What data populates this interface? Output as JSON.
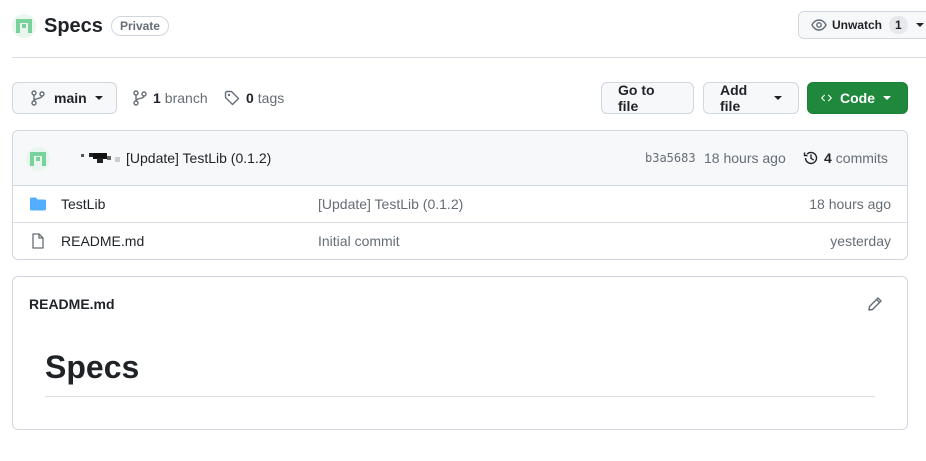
{
  "repo": {
    "name": "Specs",
    "visibility": "Private",
    "avatar_icon": "repo-avatar-identicon"
  },
  "watch": {
    "label": "Unwatch",
    "count": "1",
    "icon": "eye-icon"
  },
  "toolbar": {
    "branch_label": "main",
    "branch_count": "1",
    "branch_word": "branch",
    "tag_count": "0",
    "tag_word": "tags",
    "go_to_file": "Go to file",
    "add_file": "Add file",
    "code": "Code"
  },
  "latest_commit": {
    "message": "[Update] TestLib (0.1.2)",
    "sha": "b3a5683",
    "time": "18 hours ago",
    "commit_count": "4",
    "commit_word": "commits"
  },
  "files": [
    {
      "type": "folder",
      "name": "TestLib",
      "commit": "[Update] TestLib (0.1.2)",
      "age": "18 hours ago"
    },
    {
      "type": "file",
      "name": "README.md",
      "commit": "Initial commit",
      "age": "yesterday"
    }
  ],
  "readme": {
    "filename": "README.md",
    "heading": "Specs"
  },
  "colors": {
    "primary_green": "#1f883d",
    "folder_blue": "#54aeff",
    "muted_text": "#656d76",
    "border": "#d0d7de"
  }
}
